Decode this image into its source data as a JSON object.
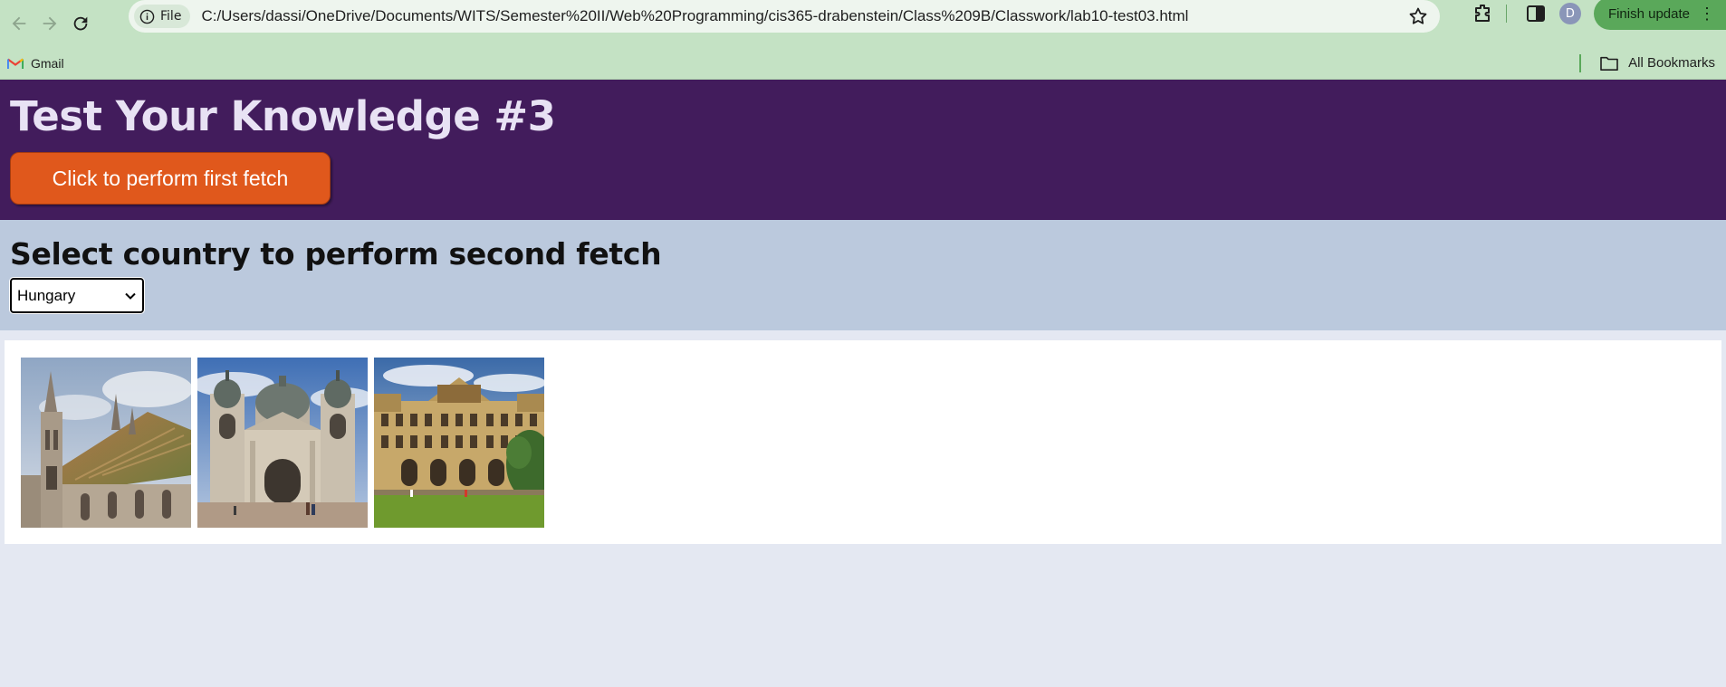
{
  "browser": {
    "site_chip_label": "File",
    "url": "C:/Users/dassi/OneDrive/Documents/WITS/Semester%20II/Web%20Programming/cis365-drabenstein/Class%209B/Classwork/lab10-test03.html",
    "avatar_letter": "D",
    "update_label": "Finish update",
    "bookmarks": [
      {
        "label": "Gmail",
        "icon": "gmail-icon"
      }
    ],
    "all_bookmarks_label": "All Bookmarks"
  },
  "page": {
    "title": "Test Your Knowledge #3",
    "first_fetch_button": "Click to perform first fetch",
    "section_title": "Select country to perform second fetch",
    "selected_country": "Hungary"
  },
  "gallery": {
    "images": [
      {
        "subject": "gothic church with twin spires and patterned tiled roof"
      },
      {
        "subject": "domed basilica with twin bell towers and plaza"
      },
      {
        "subject": "ornate palace facade with green lawn"
      }
    ]
  },
  "colors": {
    "header_bg": "#421c5c",
    "title_color": "#e8e2f4",
    "button_bg": "#e0581c",
    "section_bg": "#bbc9dd",
    "page_bg": "#e4e8f2",
    "browser_chrome": "#c4e2c4"
  }
}
